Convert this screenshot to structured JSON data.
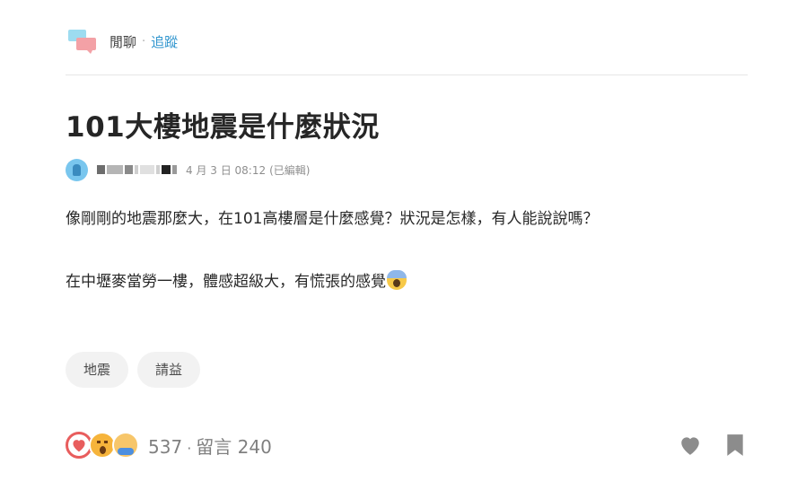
{
  "board": {
    "name": "閒聊",
    "separator": "·",
    "follow_label": "追蹤"
  },
  "post": {
    "title": "101大樓地震是什麼狀況",
    "date": "4 月 3 日 08:12",
    "edited_label": "(已編輯)",
    "paragraphs": [
      "像剛剛的地震那麼大，在101高樓層是什麼感覺？狀況是怎樣，有人能說說嗎？",
      "在中壢麥當勞一樓，體感超級大，有慌張的感覺"
    ],
    "emoji_icon": "face-screaming-icon"
  },
  "tags": [
    "地震",
    "請益"
  ],
  "footer": {
    "reaction_icons": [
      "heart-icon",
      "surprised-face-icon",
      "crying-face-icon"
    ],
    "like_count": "537",
    "separator": "·",
    "comments_label": "留言 240",
    "action_icons": [
      "heart-outline-icon",
      "bookmark-icon"
    ]
  },
  "colors": {
    "accent": "#3397cf",
    "heart": "#e85d5d",
    "tag_bg": "#f2f2f2",
    "icon_gray": "#8c8c8c"
  }
}
